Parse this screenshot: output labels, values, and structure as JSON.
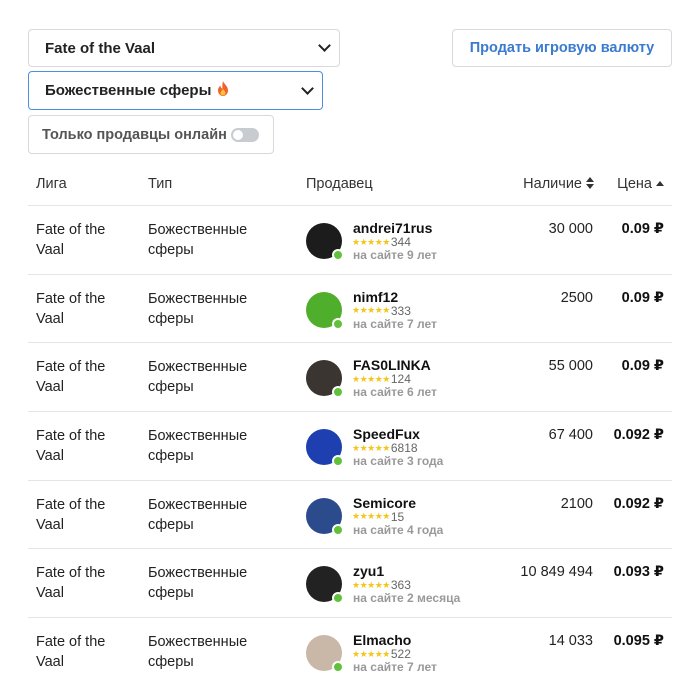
{
  "filters": {
    "league": "Fate of the Vaal",
    "type": "Божественные сферы",
    "type_icon": "fire-icon",
    "online_only_label": "Только продавцы онлайн",
    "online_only_on": false
  },
  "sell_button": "Продать игровую валюту",
  "table": {
    "headers": {
      "league": "Лига",
      "type": "Тип",
      "seller": "Продавец",
      "stock": "Наличие",
      "price": "Цена"
    },
    "rows": [
      {
        "league": "Fate of the Vaal",
        "type": "Божественные сферы",
        "seller": "andrei71rus",
        "reviews": "344",
        "since": "на сайте 9 лет",
        "stock": "30 000",
        "price": "0.09 ₽",
        "avatar_color": "#1c1c1c"
      },
      {
        "league": "Fate of the Vaal",
        "type": "Божественные сферы",
        "seller": "nimf12",
        "reviews": "333",
        "since": "на сайте 7 лет",
        "stock": "2500",
        "price": "0.09 ₽",
        "avatar_color": "#4fae2c"
      },
      {
        "league": "Fate of the Vaal",
        "type": "Божественные сферы",
        "seller": "FAS0LINKA",
        "reviews": "124",
        "since": "на сайте 6 лет",
        "stock": "55 000",
        "price": "0.09 ₽",
        "avatar_color": "#3a3530"
      },
      {
        "league": "Fate of the Vaal",
        "type": "Божественные сферы",
        "seller": "SpeedFux",
        "reviews": "6818",
        "since": "на сайте 3 года",
        "stock": "67 400",
        "price": "0.092 ₽",
        "avatar_color": "#1e3fb0"
      },
      {
        "league": "Fate of the Vaal",
        "type": "Божественные сферы",
        "seller": "Semicore",
        "reviews": "15",
        "since": "на сайте 4 года",
        "stock": "2100",
        "price": "0.092 ₽",
        "avatar_color": "#2b4b8c"
      },
      {
        "league": "Fate of the Vaal",
        "type": "Божественные сферы",
        "seller": "zyu1",
        "reviews": "363",
        "since": "на сайте 2 месяца",
        "stock": "10 849 494",
        "price": "0.093 ₽",
        "avatar_color": "#222222"
      },
      {
        "league": "Fate of the Vaal",
        "type": "Божественные сферы",
        "seller": "Elmacho",
        "reviews": "522",
        "since": "на сайте 7 лет",
        "stock": "14 033",
        "price": "0.095 ₽",
        "avatar_color": "#c9b8a8"
      }
    ]
  }
}
